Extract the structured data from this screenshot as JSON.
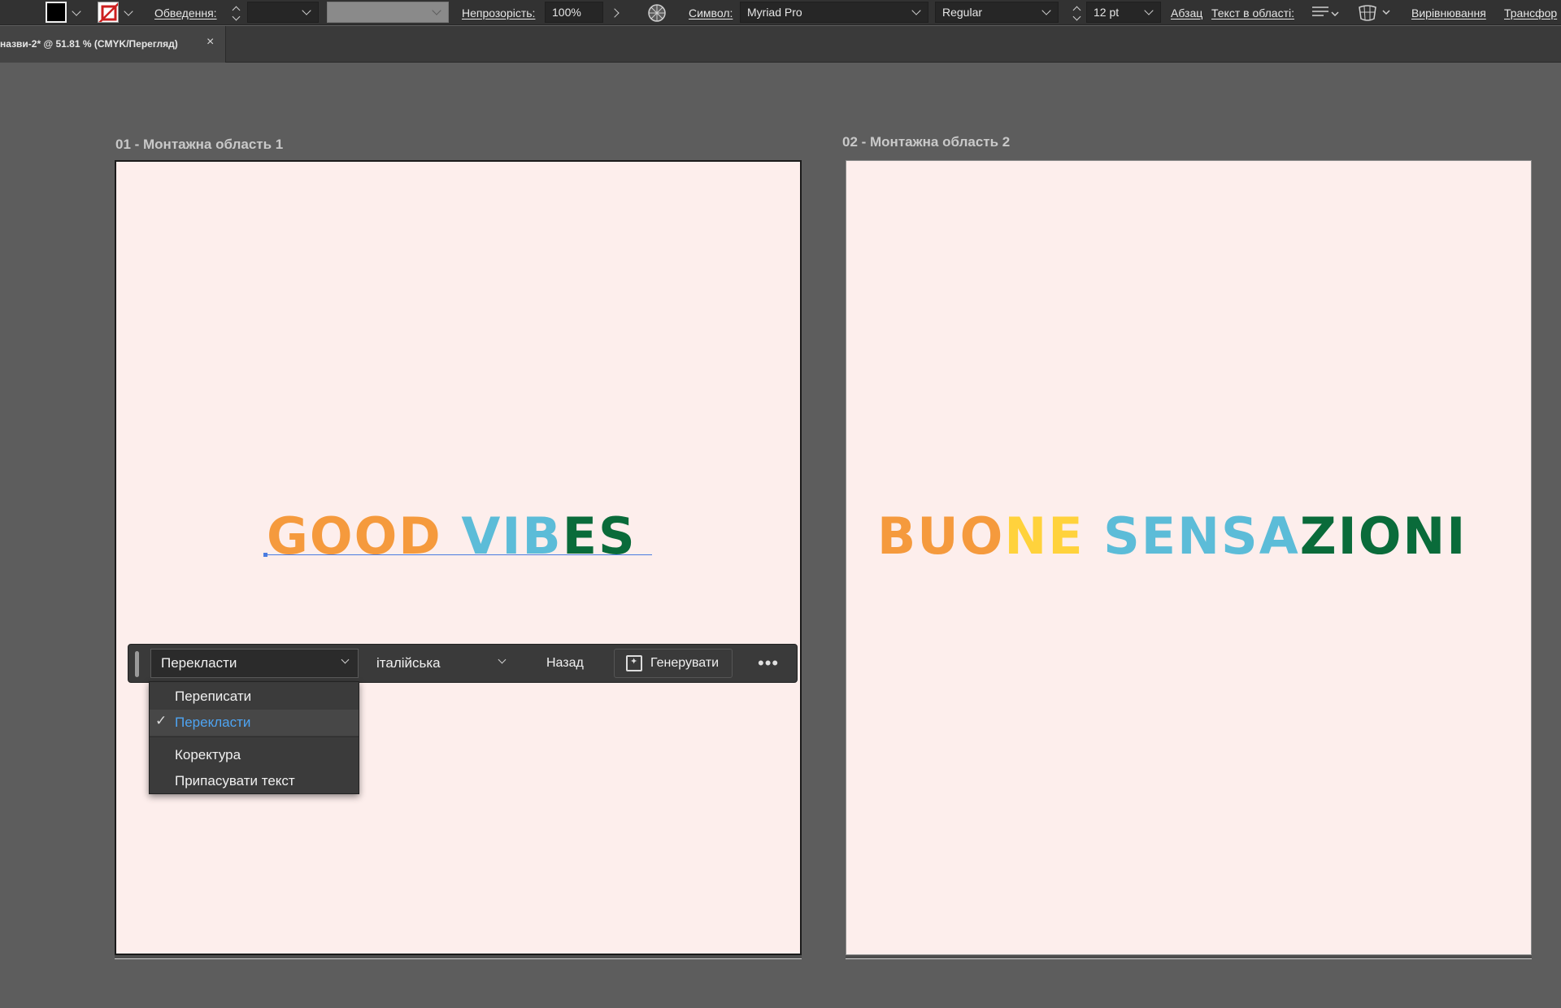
{
  "control_bar": {
    "stroke_label": "Обведення:",
    "opacity_label": "Непрозорість:",
    "opacity_value": "100%",
    "character_label": "Символ:",
    "font_family": "Myriad Pro",
    "font_style": "Regular",
    "font_size": "12 pt",
    "paragraph_label": "Абзац",
    "area_type_label": "Текст в області:",
    "align_label": "Вирівнювання",
    "transform_label": "Трансфор"
  },
  "tab": {
    "title": "назви-2* @ 51.81 % (CMYK/Перегляд)",
    "close": "×"
  },
  "artboard1": {
    "label": "01 - Монтажна область 1",
    "word_segments": [
      {
        "text": "GOOD",
        "color": "#f59a3d"
      },
      {
        "text": " ",
        "color": "#f59a3d"
      },
      {
        "text": "VIB",
        "color": "#5cbcd8"
      },
      {
        "text": "ES",
        "color": "#0a6b3a"
      }
    ]
  },
  "artboard2": {
    "label": "02 - Монтажна область 2",
    "word_segments": [
      {
        "text": "BUO",
        "color": "#f59a3d"
      },
      {
        "text": "NE",
        "color": "#ffd23c"
      },
      {
        "text": " ",
        "color": "#ffd23c"
      },
      {
        "text": "SENSA",
        "color": "#5cbcd8"
      },
      {
        "text": "ZIONI",
        "color": "#0a6b3a"
      }
    ]
  },
  "task_bar": {
    "mode": "Перекласти",
    "language": "італійська",
    "back": "Назад",
    "generate": "Генерувати",
    "more": "•••"
  },
  "mode_menu": {
    "items": [
      {
        "label": "Переписати",
        "selected": false
      },
      {
        "label": "Перекласти",
        "selected": true
      },
      {
        "label": "Коректура",
        "selected": false
      },
      {
        "label": "Припасувати текст",
        "selected": false
      }
    ],
    "check": "✓"
  },
  "colors": {
    "orange": "#f59a3d",
    "yellow": "#ffd23c",
    "blue": "#5cbcd8",
    "green": "#0a6b3a",
    "artboard_bg": "#fdeeec",
    "selection_blue": "#4ea4f2"
  }
}
